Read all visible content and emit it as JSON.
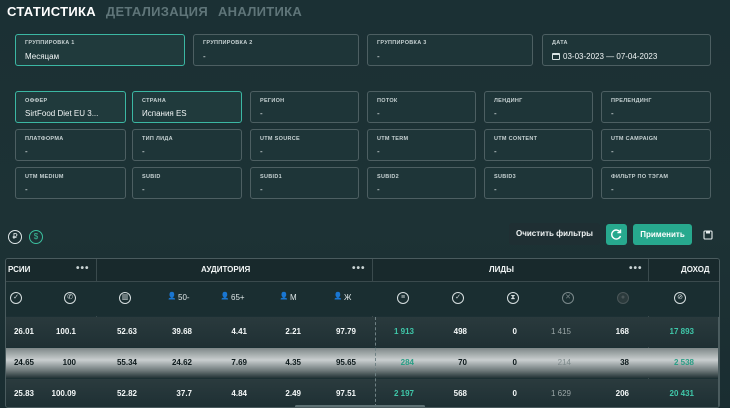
{
  "tabs": [
    "СТАТИСТИКА",
    "ДЕТАЛИЗАЦИЯ",
    "АНАЛИТИКА"
  ],
  "groupings": [
    {
      "label": "ГРУППИРОВКА 1",
      "value": "Месяцам"
    },
    {
      "label": "ГРУППИРОВКА 2",
      "value": "-"
    },
    {
      "label": "ГРУППИРОВКА 3",
      "value": "-"
    },
    {
      "label": "ДАТА",
      "value": "03-03-2023 — 07-04-2023"
    }
  ],
  "filters": [
    {
      "label": "ОФФЕР",
      "value": "SirtFood Diet EU 3..."
    },
    {
      "label": "СТРАНА",
      "value": "Испания ES"
    },
    {
      "label": "РЕГИОН",
      "value": "-"
    },
    {
      "label": "ПОТОК",
      "value": "-"
    },
    {
      "label": "ЛЕНДИНГ",
      "value": "-"
    },
    {
      "label": "ПРЕЛЕНДИНГ",
      "value": "-"
    },
    {
      "label": "ПЛАТФОРМА",
      "value": "-"
    },
    {
      "label": "ТИП ЛИДА",
      "value": "-"
    },
    {
      "label": "UTM SOURCE",
      "value": "-"
    },
    {
      "label": "UTM TERM",
      "value": "-"
    },
    {
      "label": "UTM CONTENT",
      "value": "-"
    },
    {
      "label": "UTM CAMPAIGN",
      "value": "-"
    },
    {
      "label": "UTM MEDIUM",
      "value": "-"
    },
    {
      "label": "SUBID",
      "value": "-"
    },
    {
      "label": "SUBID1",
      "value": "-"
    },
    {
      "label": "SUBID2",
      "value": "-"
    },
    {
      "label": "SUBID3",
      "value": "-"
    },
    {
      "label": "ФИЛЬТР ПО ТЭГАМ",
      "value": "-"
    }
  ],
  "currency": {
    "rub": "₽",
    "usd": "$"
  },
  "actions": {
    "clear": "Очистить фильтры",
    "apply": "Применить"
  },
  "table": {
    "groups": {
      "versions": "РСИИ",
      "audience": "АУДИТОРИЯ",
      "leads": "ЛИДЫ",
      "income": "ДОХОД",
      "more": "•••"
    },
    "audience_cols": {
      "age_young": "50-",
      "age_old": "65+",
      "male": "М",
      "female": "Ж"
    },
    "rows": [
      [
        "26.01",
        "100.1",
        "52.63",
        "39.68",
        "4.41",
        "2.21",
        "97.79",
        "1 913",
        "498",
        "0",
        "1 415",
        "168",
        "17 893"
      ],
      [
        "24.65",
        "100",
        "55.34",
        "24.62",
        "7.69",
        "4.35",
        "95.65",
        "284",
        "70",
        "0",
        "214",
        "38",
        "2 538"
      ],
      [
        "25.83",
        "100.09",
        "52.82",
        "37.7",
        "4.84",
        "2.49",
        "97.51",
        "2 197",
        "568",
        "0",
        "1 629",
        "206",
        "20 431"
      ]
    ]
  }
}
